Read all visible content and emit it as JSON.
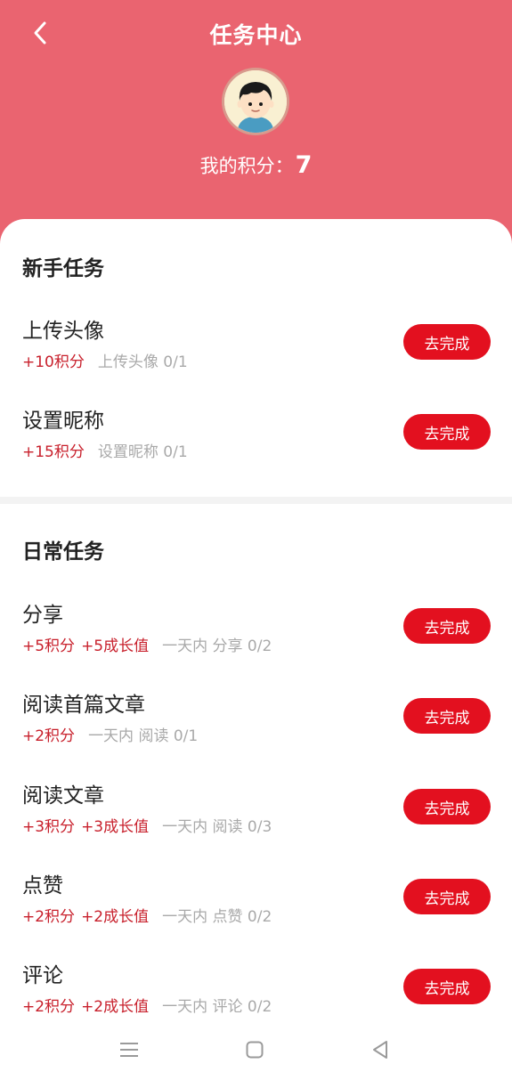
{
  "header": {
    "title": "任务中心",
    "points_label": "我的积分：",
    "points_value": "7",
    "accent_color": "#ea6470"
  },
  "newbie": {
    "title": "新手任务",
    "tasks": [
      {
        "name": "上传头像",
        "rewards": [
          "+10积分"
        ],
        "progress": "上传头像 0/1",
        "button": "去完成"
      },
      {
        "name": "设置昵称",
        "rewards": [
          "+15积分"
        ],
        "progress": "设置昵称 0/1",
        "button": "去完成"
      }
    ]
  },
  "daily": {
    "title": "日常任务",
    "tasks": [
      {
        "name": "分享",
        "rewards": [
          "+5积分",
          "+5成长值"
        ],
        "progress": "一天内 分享 0/2",
        "button": "去完成"
      },
      {
        "name": "阅读首篇文章",
        "rewards": [
          "+2积分"
        ],
        "progress": "一天内 阅读 0/1",
        "button": "去完成"
      },
      {
        "name": "阅读文章",
        "rewards": [
          "+3积分",
          "+3成长值"
        ],
        "progress": "一天内 阅读 0/3",
        "button": "去完成"
      },
      {
        "name": "点赞",
        "rewards": [
          "+2积分",
          "+2成长值"
        ],
        "progress": "一天内 点赞 0/2",
        "button": "去完成"
      },
      {
        "name": "评论",
        "rewards": [
          "+2积分",
          "+2成长值"
        ],
        "progress": "一天内 评论 0/2",
        "button": "去完成"
      }
    ]
  },
  "colors": {
    "reward": "#c8202c",
    "button": "#e3101f",
    "muted": "#a9a9a9"
  },
  "navbar": {
    "icons": [
      "menu-icon",
      "home-square-icon",
      "back-triangle-icon"
    ]
  }
}
